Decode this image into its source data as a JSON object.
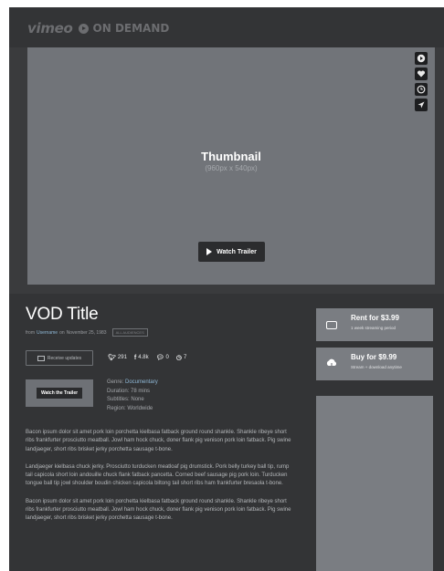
{
  "brand": {
    "vimeo": "vimeo",
    "ondemand": "ON DEMAND"
  },
  "player": {
    "title": "Thumbnail",
    "size_text": "(960px x 540px)",
    "trailer_button": "Watch Trailer",
    "side_icons": [
      "play-circle-icon",
      "heart-icon",
      "clock-icon",
      "send-icon"
    ]
  },
  "vod": {
    "title": "VOD Title",
    "byline_prefix": "from",
    "username": "Username",
    "byline_on": "on",
    "date": "November 25, 1983",
    "tag": "ALL AUDIENCES"
  },
  "actions": {
    "review_button": "Receive updates"
  },
  "stats": {
    "twitter": "291",
    "facebook": "4.8k",
    "comments": "0",
    "views": "7"
  },
  "mini": {
    "watch_button": "Watch the Trailer"
  },
  "details": {
    "genre_label": "Genre:",
    "genre_value": "Documentary",
    "duration_label": "Duration:",
    "duration_value": "78 mins",
    "subtitles_label": "Subtitles:",
    "subtitles_value": "None",
    "region_label": "Region:",
    "region_value": "Worldwide"
  },
  "description": [
    "Bacon ipsum dolor sit amet pork loin porchetta kielbasa fatback ground round shankle. Shankle ribeye short ribs frankfurter prosciutto meatball. Jowl ham hock chuck, doner flank pig venison pork loin fatback. Pig swine landjaeger, short ribs brisket jerky porchetta sausage t-bone.",
    "Landjaeger kielbasa chuck jerky. Prosciutto turducken meatloaf pig drumstick. Pork belly turkey ball tip, rump tail capicola short loin andouille chuck flank fatback pancetta. Corned beef sausage pig pork loin. Turducken tongue ball tip jowl shoulder boudin chicken capicola biltong tail short ribs ham frankfurter bresaola t-bone.",
    "Bacon ipsum dolor sit amet pork loin porchetta kielbasa fatback ground round shankle. Shankle ribeye short ribs frankfurter prosciutto meatball. Jowl ham hock chuck, doner flank pig venison pork loin fatback. Pig swine landjaeger, short ribs brisket jerky porchetta sausage t-bone."
  ],
  "purchase": {
    "rent_label": "Rent for $3.99",
    "rent_sub": "1 week streaming period",
    "buy_label": "Buy for $9.99",
    "buy_sub": "Stream + download anytime"
  },
  "colors": {
    "background": "#333436",
    "player": "#717479",
    "card": "#7a7d82",
    "link": "#8fb8d6"
  }
}
